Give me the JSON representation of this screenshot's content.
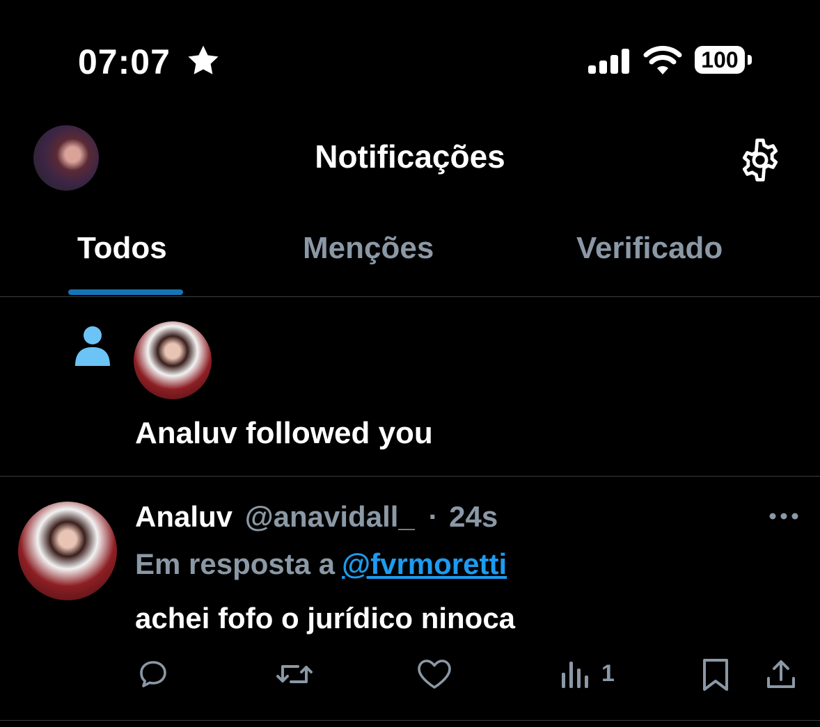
{
  "status_bar": {
    "time": "07:07",
    "battery": "100",
    "icons": [
      "star-icon",
      "signal-icon",
      "wifi-icon",
      "battery-icon"
    ]
  },
  "header": {
    "title": "Notificações",
    "icons": [
      "profile-avatar",
      "gear-icon"
    ]
  },
  "tabs": [
    {
      "label": "Todos",
      "active": true
    },
    {
      "label": "Menções",
      "active": false
    },
    {
      "label": "Verificado",
      "active": false
    }
  ],
  "notifications": [
    {
      "type": "follow",
      "icon": "person-icon",
      "text": "Analuv followed you"
    },
    {
      "type": "reply",
      "author": "Analuv",
      "handle": "@anavidall_",
      "separator": "·",
      "time": "24s",
      "reply_prefix": "Em resposta a",
      "reply_to": "@fvrmoretti",
      "text": "achei fofo o jurídico ninoca",
      "views": "1",
      "actions": [
        "reply-icon",
        "retweet-icon",
        "like-icon",
        "views-icon",
        "bookmark-icon",
        "share-icon"
      ]
    }
  ],
  "colors": {
    "background": "#000000",
    "text": "#ffffff",
    "muted": "#8b98a5",
    "accent": "#1d9bf0",
    "divider": "#3a3d40"
  }
}
